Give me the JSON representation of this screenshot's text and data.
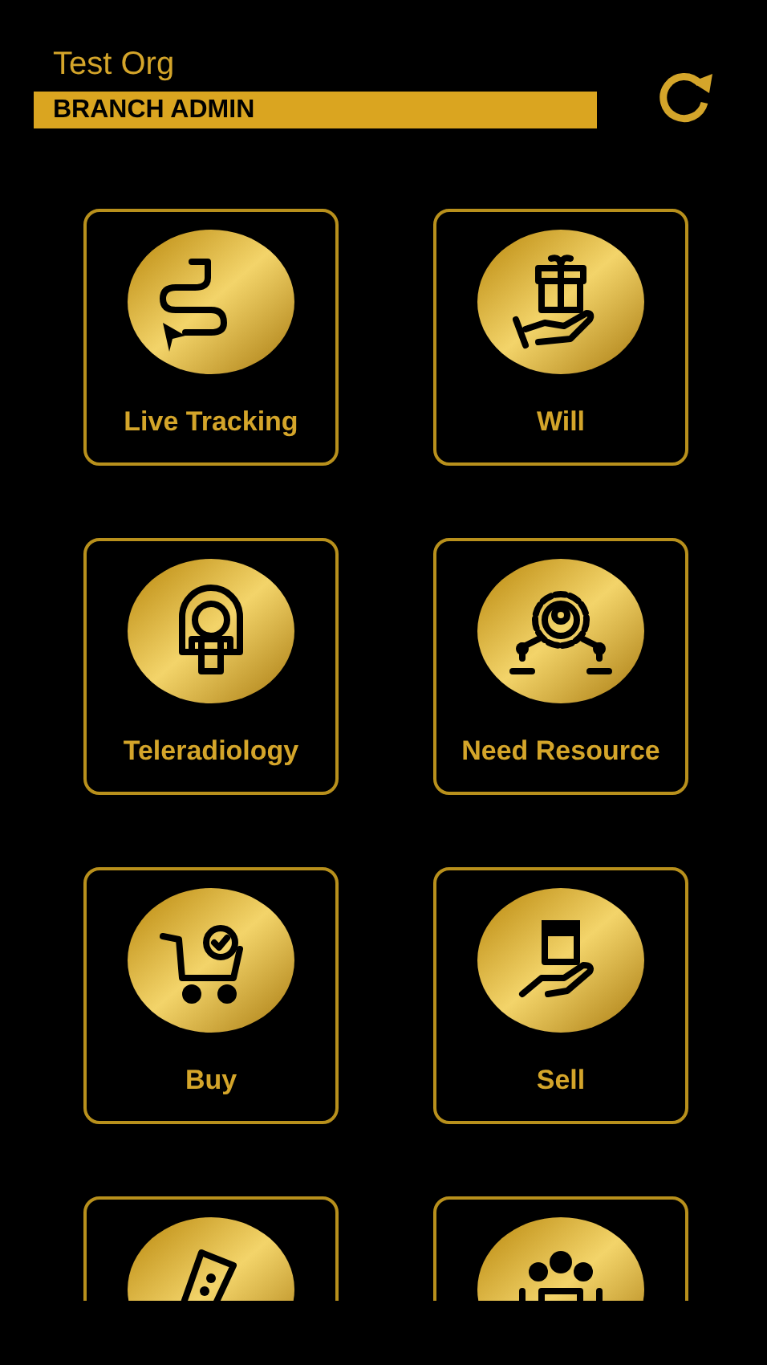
{
  "header": {
    "org_name": "Test Org",
    "role": "BRANCH ADMIN"
  },
  "tiles": [
    {
      "kind": "route",
      "label": "Live Tracking"
    },
    {
      "kind": "gift",
      "label": "Will"
    },
    {
      "kind": "scanner",
      "label": "Teleradiology"
    },
    {
      "kind": "network",
      "label": "Need Resource"
    },
    {
      "kind": "cart",
      "label": "Buy"
    },
    {
      "kind": "box",
      "label": "Sell"
    },
    {
      "kind": "tube"
    },
    {
      "kind": "group"
    }
  ]
}
